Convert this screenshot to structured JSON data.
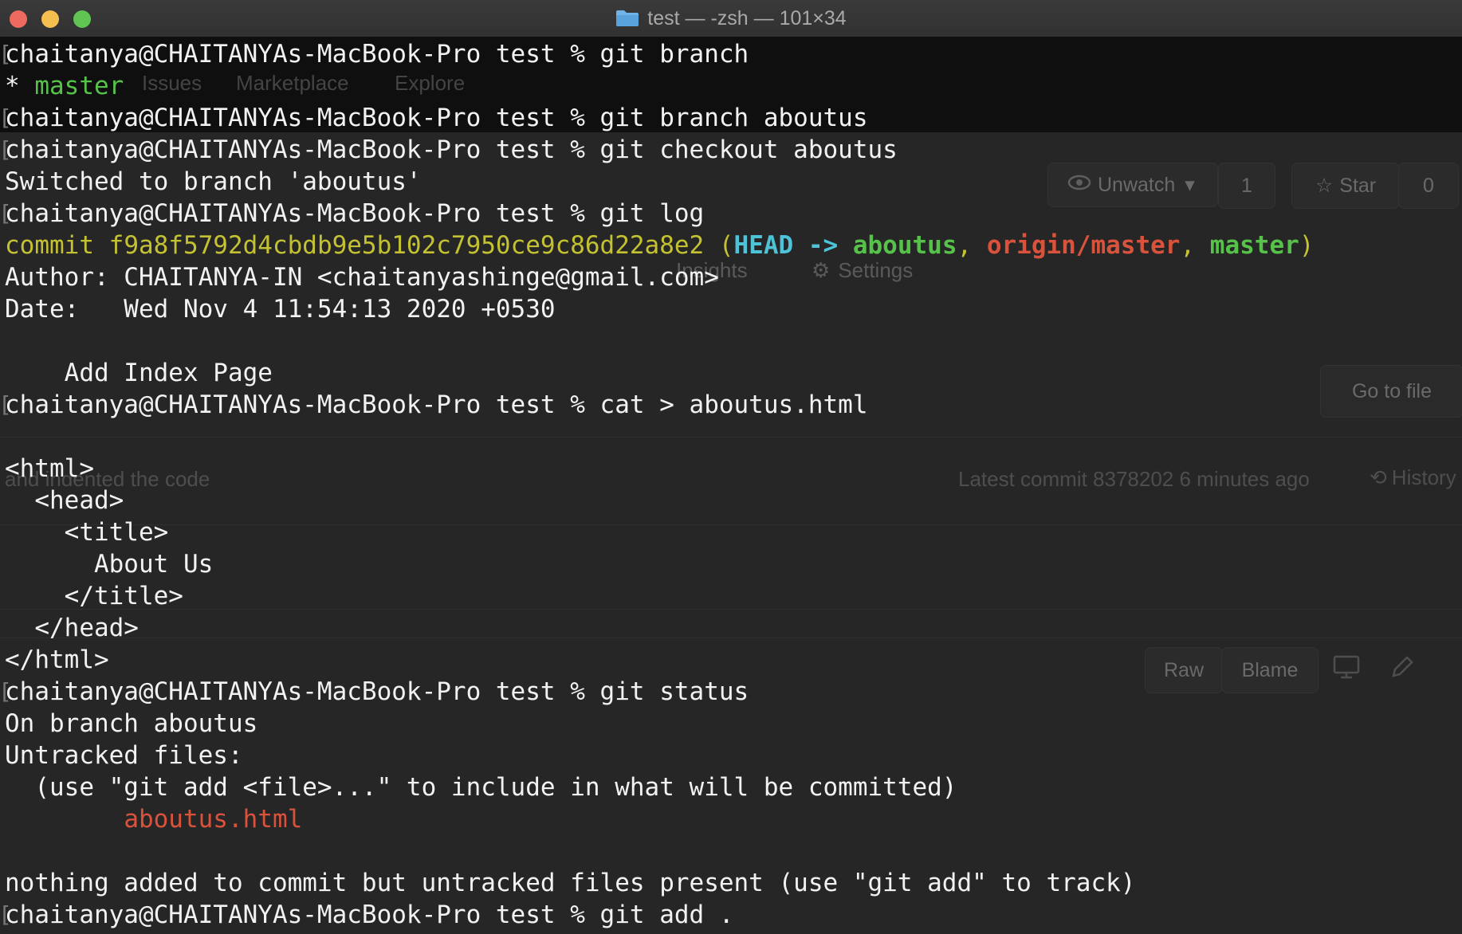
{
  "window": {
    "title": "test — -zsh — 101×34"
  },
  "background_window": {
    "nav": [
      "Issues",
      "Marketplace",
      "Explore"
    ],
    "unwatch_label": "Unwatch",
    "unwatch_count": "1",
    "star_label": "Star",
    "star_count": "0",
    "insights_label": "Insights",
    "settings_label": "Settings",
    "go_to_file": "Go to file",
    "commit_msg": "and indented the code",
    "latest_commit": "Latest commit 8378202 6 minutes ago",
    "history": "History",
    "raw": "Raw",
    "blame": "Blame"
  },
  "terminal": {
    "prompt": "chaitanya@CHAITANYAs-MacBook-Pro test % ",
    "cmd_branch": "git branch",
    "branch_star": "* ",
    "branch_master": "master",
    "cmd_branch_create": "git branch aboutus",
    "cmd_checkout": "git checkout aboutus",
    "switched": "Switched to branch 'aboutus'",
    "cmd_log": "git log",
    "commit_word": "commit ",
    "commit_hash": "f9a8f5792d4cbdb9e5b102c7950ce9c86d22a8e2",
    "paren_open": " (",
    "head": "HEAD -> ",
    "ref_aboutus": "aboutus",
    "comma1": ", ",
    "ref_origin": "origin/master",
    "comma2": ", ",
    "ref_master": "master",
    "paren_close": ")",
    "author": "Author: CHAITANYA-IN <chaitanyashinge@gmail.com>",
    "date": "Date:   Wed Nov 4 11:54:13 2020 +0530",
    "commit_message": "    Add Index Page",
    "cmd_cat": "cat > aboutus.html",
    "html_lines": [
      "<html>",
      "  <head>",
      "    <title>",
      "      About Us",
      "    </title>",
      "  </head>",
      "</html>"
    ],
    "cmd_status": "git status",
    "on_branch": "On branch aboutus",
    "untracked": "Untracked files:",
    "use_hint": "  (use \"git add <file>...\" to include in what will be committed)",
    "untracked_file": "aboutus.html",
    "nothing_added": "nothing added to commit but untracked files present (use \"git add\" to track)",
    "cmd_add": "git add ."
  },
  "colors": {
    "hash": "#c4c232",
    "head": "#4ec3d8",
    "branch_local": "#56c24a",
    "branch_remote": "#d9533c"
  }
}
